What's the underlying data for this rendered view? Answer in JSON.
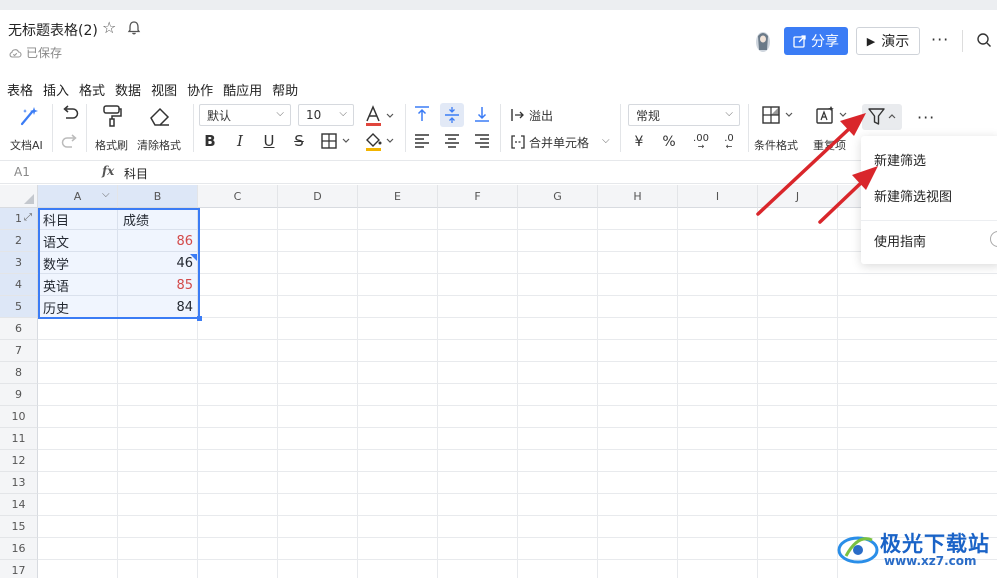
{
  "header": {
    "title": "无标题表格(2)",
    "saved_status": "已保存",
    "share_label": "分享",
    "present_label": "演示",
    "more_label": "···"
  },
  "menu": {
    "items": [
      "表格",
      "插入",
      "格式",
      "数据",
      "视图",
      "协作",
      "酷应用",
      "帮助"
    ]
  },
  "toolbar": {
    "ai_label": "文档AI",
    "format_painter_label": "格式刷",
    "clear_format_label": "清除格式",
    "font_family": "默认",
    "font_size": "10",
    "overflow_label": "溢出",
    "merge_label": "合并单元格",
    "number_format": "常规",
    "percent_label": "%",
    "decimal_label": ".00",
    "currency_label": "¥",
    "cond_format_label": "条件格式",
    "repeat_label": "重复项",
    "more_label": "···"
  },
  "formula_bar": {
    "cell_ref": "A1",
    "fx_label": "fx",
    "content": "科目"
  },
  "grid": {
    "columns": [
      "A",
      "B",
      "C",
      "D",
      "E",
      "F",
      "G",
      "H",
      "I",
      "J"
    ],
    "rows": [
      "1",
      "2",
      "3",
      "4",
      "5",
      "6",
      "7",
      "8",
      "9",
      "10",
      "11",
      "12",
      "13",
      "14",
      "15",
      "16",
      "17"
    ],
    "data": [
      {
        "a": "科目",
        "b": "成绩",
        "b_color": "#222222"
      },
      {
        "a": "语文",
        "b": "86",
        "b_color": "#e0463c"
      },
      {
        "a": "数学",
        "b": "46",
        "b_color": "#222222"
      },
      {
        "a": "英语",
        "b": "85",
        "b_color": "#e0463c"
      },
      {
        "a": "历史",
        "b": "84",
        "b_color": "#222222"
      }
    ]
  },
  "filter_menu": {
    "items": [
      "新建筛选",
      "新建筛选视图",
      "使用指南"
    ]
  },
  "watermark": {
    "text": "极光下载站",
    "url": "www.xz7.com"
  },
  "colors": {
    "accent": "#3b7cf5",
    "red_value": "#e0463c",
    "arrow": "#d9262b"
  }
}
